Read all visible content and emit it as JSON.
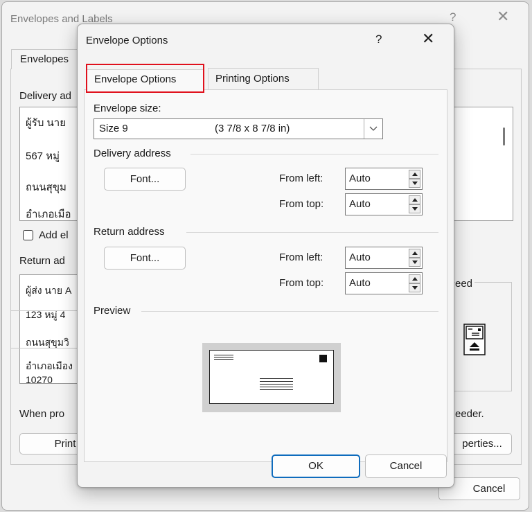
{
  "colors": {
    "highlight": "#e0101c",
    "default_button_border": "#0f6cbd"
  },
  "background_dialog": {
    "title": "Envelopes and Labels",
    "help_glyph": "?",
    "close_glyph": "✕",
    "tab_envelopes": "Envelopes",
    "delivery_label": "Delivery ad",
    "delivery_lines": [
      "ผู้รับ นาย",
      "567 หมู่",
      "ถนนสุขุม",
      "อำเภอเมือ"
    ],
    "add_checkbox_label": "Add el",
    "return_label": "Return ad",
    "return_lines": [
      "ผู้ส่ง นาย A",
      "123 หมู่ 4",
      "ถนนสุขุมวิ",
      "อำเภอเมือง",
      "10270"
    ],
    "feed_label": "eed",
    "notice_left": "When pro",
    "notice_right": "eeder.",
    "print_button": "Print",
    "properties_button": "perties...",
    "cancel_button": "Cancel"
  },
  "dialog": {
    "title": "Envelope Options",
    "help_glyph": "?",
    "close_glyph": "✕",
    "tabs": [
      {
        "label": "Envelope Options",
        "selected": true
      },
      {
        "label": "Printing Options",
        "selected": false
      }
    ],
    "envelope_size_label": "Envelope size:",
    "envelope_size_value": "Size 9",
    "envelope_size_dims": "(3 7/8 x 8 7/8 in)",
    "delivery": {
      "section_label": "Delivery address",
      "font_button": "Font...",
      "from_left_label": "From left:",
      "from_left_value": "Auto",
      "from_top_label": "From top:",
      "from_top_value": "Auto"
    },
    "return": {
      "section_label": "Return address",
      "font_button": "Font...",
      "from_left_label": "From left:",
      "from_left_value": "Auto",
      "from_top_label": "From top:",
      "from_top_value": "Auto"
    },
    "preview_label": "Preview",
    "ok_button": "OK",
    "cancel_button": "Cancel"
  }
}
